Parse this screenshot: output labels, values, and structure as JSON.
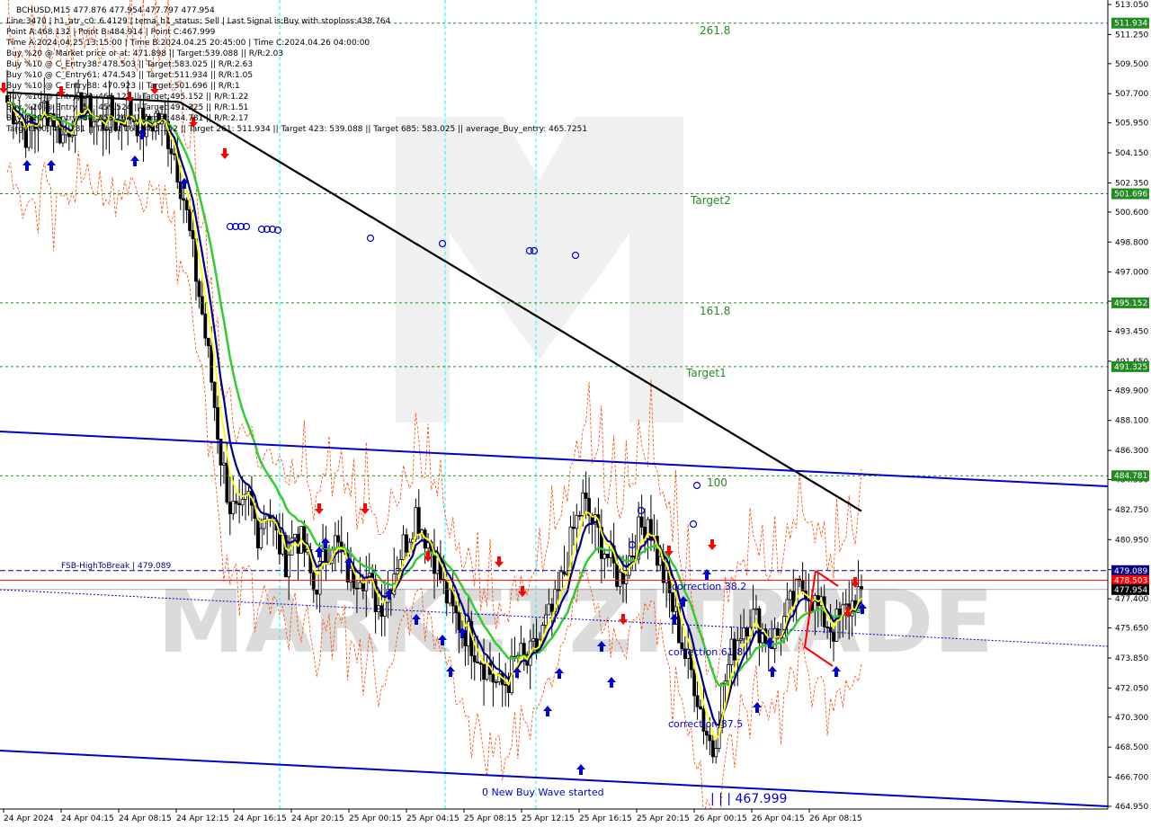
{
  "header": {
    "symbol_line": "BCHUSD,M15  477.876 477.954 477.797 477.954",
    "info_lines": [
      "Line:3470 | h1_atr_c0: 6.4129 | tema_h1_status: Sell | Last Signal is:Buy with stoploss:438.764",
      "Point A:468.132 | Point B:484.914 | Point C:467.999",
      "Time A:2024.04.25 13:15:00 | Time B:2024.04.25 20:45:00 | Time C:2024.04.26 04:00:00",
      "Buy %20 @ Market price or at: 471.898 || Target:539.088 || R/R:2.03",
      "Buy %10 @ C_Entry38: 478.503 || Target:583.025 || R/R:2.63",
      "Buy %10 @ C_Entry61: 474.543 || Target:511.934 || R/R:1.05",
      "Buy %10 @ C_Entry88: 470.923 || Target:501.696 || R/R:1",
      "Buy %10 @ Entry -23: 464.122 || Target:495.152 || R/R:1.22",
      "Buy %20 @ Entry -50: 459.524 || Target:491.325 || R/R:1.51",
      "Buy %20 @ Entry -88: 453.264 || Target:484.781 || R/R:2.17",
      "Target100: 484.781 || Target 161: 495.152 || Target 261: 511.934 || Target 423: 539.088 || Target 685: 583.025 || average_Buy_entry: 465.7251"
    ]
  },
  "watermark": "MARKETZITRADE",
  "annotations": {
    "fib_261": "261.8",
    "target2": "Target2",
    "fib_161": "161.8",
    "target1": "Target1",
    "fib_100": "100",
    "fsb": "FSB-HighToBreak | 479.089",
    "correction_38": "correction 38.2",
    "correction_61": "correction 61.8",
    "correction_87": "correction 87.5",
    "new_buy_wave": "0 New Buy Wave started",
    "point_c": "| | | 467.999"
  },
  "colors": {
    "background": "#ffffff",
    "bull_candle": "#ffffff",
    "bear_candle": "#000000",
    "grid": "#d9d9d9",
    "ema_black": "#000000",
    "ema_green": "#33cc33",
    "tema_navy": "#000080",
    "yellow": "#ffff00",
    "channel_blue": "#0000cd",
    "target_green": "#228b22",
    "envelope_orange": "#ff4500",
    "fsb_navy": "#00008b",
    "stop_red": "#ff0000",
    "cyan_vline": "#00ffff"
  },
  "price_tags": [
    {
      "value": "511.934",
      "color": "#228b22"
    },
    {
      "value": "501.696",
      "color": "#228b22"
    },
    {
      "value": "495.152",
      "color": "#228b22"
    },
    {
      "value": "491.325",
      "color": "#228b22"
    },
    {
      "value": "484.781",
      "color": "#228b22"
    },
    {
      "value": "479.089",
      "color": "#00008b"
    },
    {
      "value": "478.503",
      "color": "#ff0000"
    },
    {
      "value": "477.954",
      "color": "#000000"
    }
  ],
  "chart_data": {
    "type": "candlestick",
    "symbol": "BCHUSD",
    "timeframe": "M15",
    "ylim": [
      464.95,
      513.05
    ],
    "y_ticks": [
      "513.050",
      "511.250",
      "509.500",
      "507.700",
      "505.950",
      "504.150",
      "502.350",
      "500.600",
      "498.800",
      "497.000",
      "495.250",
      "493.450",
      "491.650",
      "489.900",
      "488.100",
      "486.300",
      "484.550",
      "482.750",
      "480.950",
      "479.150",
      "477.400",
      "475.650",
      "473.850",
      "472.050",
      "470.300",
      "468.500",
      "466.700",
      "464.950"
    ],
    "x_ticks": [
      "24 Apr 2024",
      "24 Apr 04:15",
      "24 Apr 08:15",
      "24 Apr 12:15",
      "24 Apr 16:15",
      "24 Apr 20:15",
      "25 Apr 00:15",
      "25 Apr 04:15",
      "25 Apr 08:15",
      "25 Apr 12:15",
      "25 Apr 16:15",
      "25 Apr 20:15",
      "26 Apr 00:15",
      "26 Apr 04:15",
      "26 Apr 08:15"
    ],
    "levels": {
      "target_261": 511.934,
      "target2": 501.696,
      "target_161": 495.152,
      "target1": 491.325,
      "target_100": 484.781,
      "fsb_high_to_break": 479.089,
      "c_entry38": 478.503,
      "last_price": 477.954
    },
    "close_path": [
      507.2,
      506.5,
      505.4,
      505.8,
      506.9,
      506.3,
      505.1,
      506.2,
      507.0,
      506.4,
      505.8,
      506.5,
      505.9,
      506.8,
      506.1,
      505.5,
      506.3,
      505.7,
      504.2,
      501.5,
      498.0,
      494.5,
      490.5,
      486.0,
      483.0,
      482.0,
      483.3,
      481.5,
      483.0,
      481.0,
      479.8,
      481.4,
      480.3,
      478.0,
      479.5,
      481.1,
      480.0,
      478.5,
      479.3,
      478.2,
      477.0,
      478.0,
      479.8,
      481.0,
      482.6,
      481.3,
      480.0,
      478.0,
      476.5,
      475.8,
      474.9,
      473.9,
      473.0,
      472.0,
      472.6,
      474.0,
      473.5,
      474.5,
      475.8,
      476.9,
      479.0,
      481.5,
      483.2,
      482.0,
      480.8,
      479.5,
      478.6,
      479.9,
      481.3,
      482.4,
      480.0,
      478.2,
      476.2,
      474.0,
      472.5,
      470.0,
      468.3,
      471.8,
      474.1,
      475.6,
      476.5,
      475.8,
      474.9,
      475.2,
      476.5,
      477.6,
      478.3,
      477.1,
      476.2,
      475.6,
      476.4,
      477.1,
      477.954
    ]
  }
}
